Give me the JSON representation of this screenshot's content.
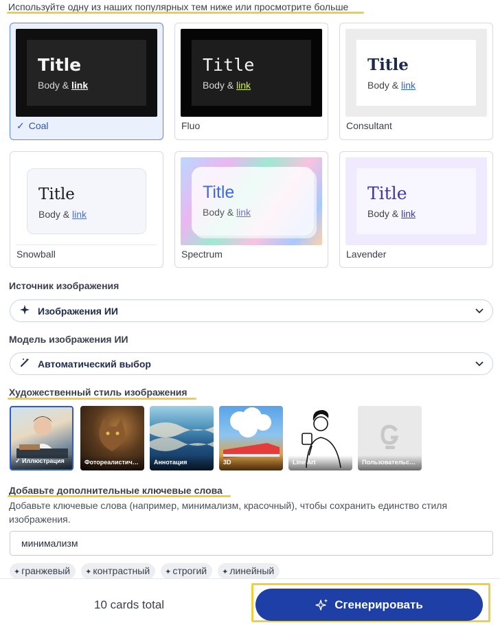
{
  "intro": "Используйте одну из наших популярных тем ниже или просмотрите больше",
  "themes": [
    {
      "name": "Coal",
      "title": "Title",
      "body": "Body &",
      "link": "link",
      "selected": true
    },
    {
      "name": "Fluo",
      "title": "Title",
      "body": "Body &",
      "link": "link",
      "selected": false
    },
    {
      "name": "Consultant",
      "title": "Title",
      "body": "Body &",
      "link": "link",
      "selected": false
    },
    {
      "name": "Snowball",
      "title": "Title",
      "body": "Body &",
      "link": "link",
      "selected": false
    },
    {
      "name": "Spectrum",
      "title": "Title",
      "body": "Body &",
      "link": "link",
      "selected": false
    },
    {
      "name": "Lavender",
      "title": "Title",
      "body": "Body &",
      "link": "link",
      "selected": false
    }
  ],
  "image_source": {
    "label": "Источник изображения",
    "value": "Изображения ИИ",
    "icon": "sparkle-icon"
  },
  "image_model": {
    "label": "Модель изображения ИИ",
    "value": "Автоматический выбор",
    "icon": "magic-wand-icon"
  },
  "art_style": {
    "label": "Художественный стиль изображения",
    "items": [
      {
        "label": "Иллюстрация",
        "selected": true
      },
      {
        "label": "Фотореалистичный",
        "selected": false
      },
      {
        "label": "Аннотация",
        "selected": false
      },
      {
        "label": "3D",
        "selected": false
      },
      {
        "label": "Line Art",
        "selected": false
      },
      {
        "label": "Пользовательский",
        "selected": false
      }
    ]
  },
  "keywords": {
    "label": "Добавьте дополнительные ключевые слова",
    "description": "Добавьте ключевые слова (например, минимализм, красочный), чтобы сохранить единство стиля изображения.",
    "value": "минимализм",
    "suggestions": [
      "гранжевый",
      "контрастный",
      "строгий",
      "линейный"
    ]
  },
  "footer": {
    "total": "10 cards total",
    "generate": "Сгенерировать"
  },
  "colors": {
    "accent": "#1d3fa6",
    "highlight": "#f0cf3c",
    "selected_border": "#5b86e5"
  }
}
